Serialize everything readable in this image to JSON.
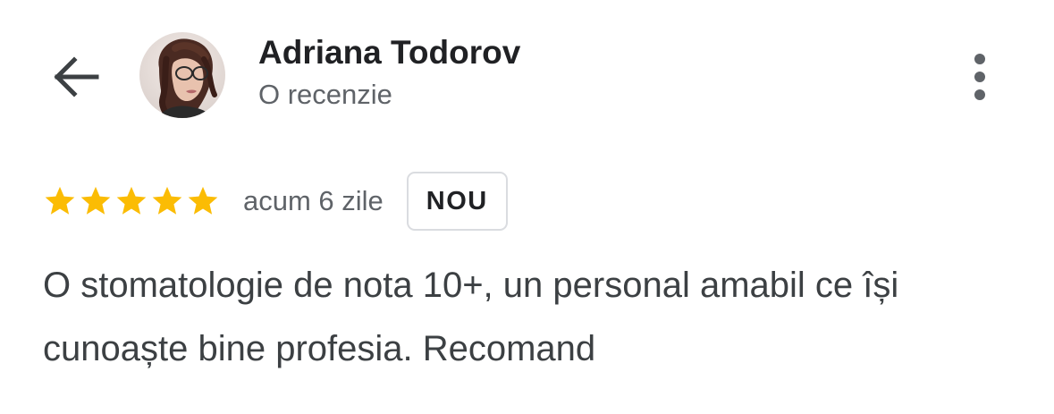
{
  "header": {
    "reviewer_name": "Adriana Todorov",
    "review_count": "O recenzie",
    "back_icon": "arrow-left-icon",
    "more_icon": "more-vert-icon"
  },
  "review": {
    "rating": 5,
    "max_rating": 5,
    "time_ago": "acum 6 zile",
    "badge": "NOU",
    "text": "O stomatologie de nota 10+, un personal amabil ce își cunoaște bine profesia. Recomand"
  },
  "colors": {
    "star": "#FBBC04",
    "name": "#202124",
    "secondary": "#5F6368",
    "body_text": "#3C4043",
    "badge_border": "#DADCE0"
  }
}
